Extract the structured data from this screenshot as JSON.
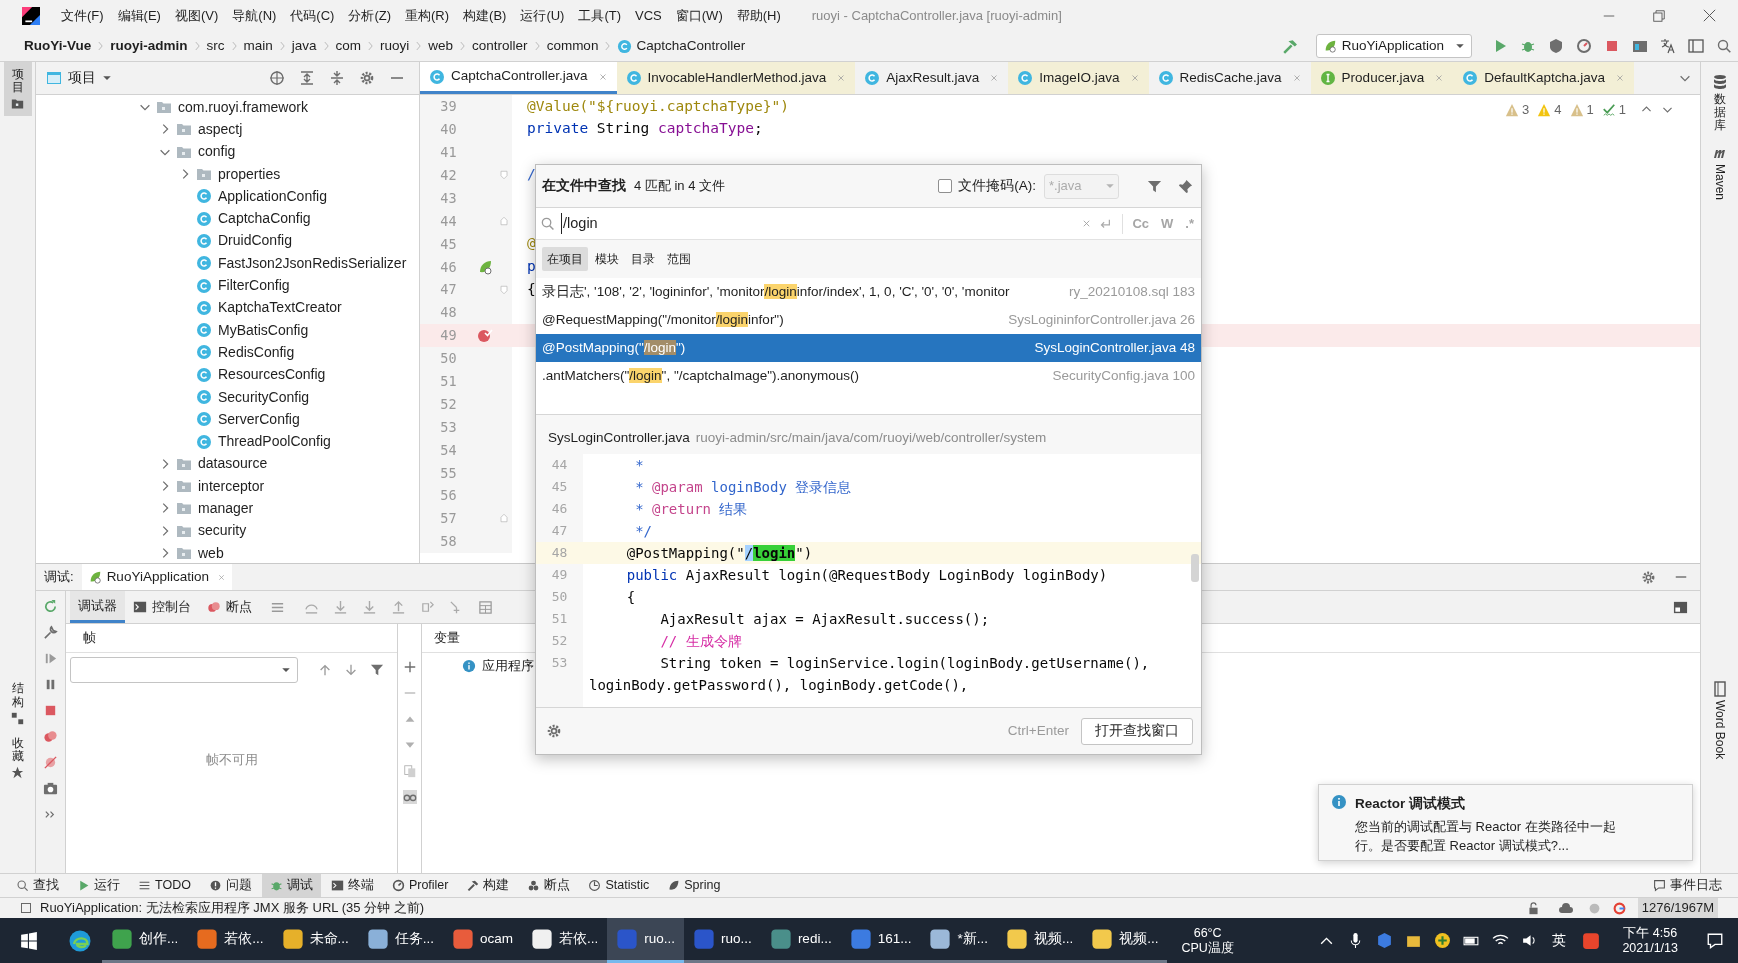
{
  "title_bar": {
    "menu": [
      "文件(F)",
      "编辑(E)",
      "视图(V)",
      "导航(N)",
      "代码(C)",
      "分析(Z)",
      "重构(R)",
      "构建(B)",
      "运行(U)",
      "工具(T)",
      "VCS",
      "窗口(W)",
      "帮助(H)"
    ],
    "title": "ruoyi - CaptchaController.java [ruoyi-admin]"
  },
  "nav_bar": {
    "breadcrumbs": [
      {
        "label": "RuoYi-Vue",
        "kind": "project"
      },
      {
        "label": "ruoyi-admin",
        "kind": "module"
      },
      {
        "label": "src",
        "kind": "dir"
      },
      {
        "label": "main",
        "kind": "dir"
      },
      {
        "label": "java",
        "kind": "dir"
      },
      {
        "label": "com",
        "kind": "dir"
      },
      {
        "label": "ruoyi",
        "kind": "dir"
      },
      {
        "label": "web",
        "kind": "dir"
      },
      {
        "label": "controller",
        "kind": "dir"
      },
      {
        "label": "common",
        "kind": "dir"
      },
      {
        "label": "CaptchaController",
        "kind": "class"
      }
    ],
    "run_config": "RuoYiApplication"
  },
  "left_stripe": [
    {
      "label": "项目",
      "selected": true
    },
    {
      "label": "结构",
      "selected": false
    },
    {
      "label": "收藏",
      "selected": false
    }
  ],
  "right_stripe": [
    {
      "label": "数据库",
      "kind": "cjk"
    },
    {
      "label": "Maven",
      "kind": "latin"
    },
    {
      "label": "Word Book",
      "kind": "latin"
    }
  ],
  "project": {
    "title": "项目",
    "tree": [
      {
        "label": "com.ruoyi.framework",
        "kind": "folder",
        "expanded": true,
        "children": [
          {
            "label": "aspectj",
            "kind": "folder",
            "expanded": false
          },
          {
            "label": "config",
            "kind": "folder",
            "expanded": true,
            "children": [
              {
                "label": "properties",
                "kind": "folder",
                "expanded": false
              },
              {
                "label": "ApplicationConfig",
                "kind": "class"
              },
              {
                "label": "CaptchaConfig",
                "kind": "class"
              },
              {
                "label": "DruidConfig",
                "kind": "class"
              },
              {
                "label": "FastJson2JsonRedisSerializer",
                "kind": "class"
              },
              {
                "label": "FilterConfig",
                "kind": "class"
              },
              {
                "label": "KaptchaTextCreator",
                "kind": "class"
              },
              {
                "label": "MyBatisConfig",
                "kind": "class"
              },
              {
                "label": "RedisConfig",
                "kind": "class"
              },
              {
                "label": "ResourcesConfig",
                "kind": "class"
              },
              {
                "label": "SecurityConfig",
                "kind": "class"
              },
              {
                "label": "ServerConfig",
                "kind": "class"
              },
              {
                "label": "ThreadPoolConfig",
                "kind": "class"
              }
            ]
          },
          {
            "label": "datasource",
            "kind": "folder",
            "expanded": false
          },
          {
            "label": "interceptor",
            "kind": "folder",
            "expanded": false
          },
          {
            "label": "manager",
            "kind": "folder",
            "expanded": false
          },
          {
            "label": "security",
            "kind": "folder",
            "expanded": false
          },
          {
            "label": "web",
            "kind": "folder",
            "expanded": false
          }
        ]
      }
    ]
  },
  "editor": {
    "tabs": [
      {
        "label": "CaptchaController.java",
        "kind": "class",
        "external": false,
        "selected": true
      },
      {
        "label": "InvocableHandlerMethod.java",
        "kind": "class",
        "external": true,
        "selected": false
      },
      {
        "label": "AjaxResult.java",
        "kind": "class",
        "external": false,
        "selected": false
      },
      {
        "label": "ImageIO.java",
        "kind": "class",
        "external": true,
        "selected": false
      },
      {
        "label": "RedisCache.java",
        "kind": "class",
        "external": false,
        "selected": false
      },
      {
        "label": "Producer.java",
        "kind": "interface",
        "external": true,
        "selected": false
      },
      {
        "label": "DefaultKaptcha.java",
        "kind": "class",
        "external": true,
        "selected": false
      }
    ],
    "inspections": [
      {
        "kind": "weak",
        "count": "3"
      },
      {
        "kind": "warning",
        "count": "4"
      },
      {
        "kind": "weak",
        "count": "1"
      },
      {
        "kind": "typo",
        "count": "1"
      }
    ],
    "lines": [
      {
        "number": "39",
        "kind": "plain",
        "highlighted": false,
        "code": [
          {
            "text": "@Value(\"${ruoyi.captchaType}\")",
            "kind": "ann"
          }
        ]
      },
      {
        "number": "40",
        "kind": "plain",
        "highlighted": false,
        "code": [
          {
            "text": "private",
            "kind": "kw"
          },
          {
            "text": " String ",
            "kind": "plain"
          },
          {
            "text": "captchaType",
            "kind": "field"
          },
          {
            "text": ";",
            "kind": "plain"
          }
        ]
      },
      {
        "number": "41",
        "kind": "plain",
        "highlighted": false
      },
      {
        "number": "42",
        "kind": "fold-start",
        "highlighted": false,
        "code": [
          {
            "text": "/",
            "kind": "doc"
          }
        ]
      },
      {
        "number": "43",
        "kind": "plain",
        "highlighted": false
      },
      {
        "number": "44",
        "kind": "fold-end",
        "highlighted": false
      },
      {
        "number": "45",
        "kind": "plain",
        "highlighted": false,
        "code": [
          {
            "text": "@",
            "kind": "ann"
          }
        ]
      },
      {
        "number": "46",
        "kind": "bean",
        "highlighted": false,
        "code": [
          {
            "text": "p",
            "kind": "kw"
          }
        ]
      },
      {
        "number": "47",
        "kind": "fold-start",
        "highlighted": false,
        "code": [
          {
            "text": "{",
            "kind": "plain"
          }
        ]
      },
      {
        "number": "48",
        "kind": "plain",
        "highlighted": false
      },
      {
        "number": "49",
        "kind": "breakpoint",
        "highlighted": true
      },
      {
        "number": "50",
        "kind": "plain",
        "highlighted": false
      },
      {
        "number": "51",
        "kind": "plain",
        "highlighted": false
      },
      {
        "number": "52",
        "kind": "plain",
        "highlighted": false
      },
      {
        "number": "53",
        "kind": "plain",
        "highlighted": false
      },
      {
        "number": "54",
        "kind": "plain",
        "highlighted": false
      },
      {
        "number": "55",
        "kind": "plain",
        "highlighted": false
      },
      {
        "number": "56",
        "kind": "plain",
        "highlighted": false
      },
      {
        "number": "57",
        "kind": "fold-end",
        "highlighted": false
      },
      {
        "number": "58",
        "kind": "plain",
        "highlighted": false
      }
    ]
  },
  "find_popup": {
    "title": "在文件中查找",
    "summary": "4 匹配 in 4 文件",
    "file_mask": {
      "label": "文件掩码(A):",
      "checked": false,
      "value": "*.java"
    },
    "search": {
      "value": "/login"
    },
    "search_options": [
      "Cc",
      "W",
      ".*"
    ],
    "scopes": [
      {
        "label": "在项目",
        "selected": true
      },
      {
        "label": "模块",
        "selected": false
      },
      {
        "label": "目录",
        "selected": false
      },
      {
        "label": "范围",
        "selected": false
      }
    ],
    "results": [
      {
        "before": "录日志', '108', '2', 'logininfor', 'monitor",
        "match": "/login",
        "after": "infor/index', 1, 0, 'C', '0', '0', 'monitor",
        "file": "ry_20210108.sql",
        "line": "183",
        "selected": false
      },
      {
        "before": "@RequestMapping(\"/monitor",
        "match": "/login",
        "after": "infor\")",
        "file": "SysLogininforController.java",
        "line": "26",
        "selected": false
      },
      {
        "before": "@PostMapping(\"",
        "match": "/login",
        "after": "\")",
        "file": "SysLoginController.java",
        "line": "48",
        "selected": true
      },
      {
        "before": ".antMatchers(\"",
        "match": "/login",
        "after": "\", \"/captchaImage\").anonymous()",
        "file": "SecurityConfig.java",
        "line": "100",
        "selected": false
      }
    ],
    "preview": {
      "file": "SysLoginController.java",
      "path": "ruoyi-admin/src/main/java/com/ruoyi/web/controller/system",
      "lines": [
        {
          "number": "44",
          "current": false,
          "code": [
            {
              "text": "     *",
              "kind": "doc"
            }
          ]
        },
        {
          "number": "45",
          "current": false,
          "code": [
            {
              "text": "     * ",
              "kind": "doc"
            },
            {
              "text": "@param",
              "kind": "tag"
            },
            {
              "text": " loginBody 登录信息",
              "kind": "doc"
            }
          ]
        },
        {
          "number": "46",
          "current": false,
          "code": [
            {
              "text": "     * ",
              "kind": "doc"
            },
            {
              "text": "@return",
              "kind": "tag"
            },
            {
              "text": " 结果",
              "kind": "doc"
            }
          ]
        },
        {
          "number": "47",
          "current": false,
          "code": [
            {
              "text": "     */",
              "kind": "doc"
            }
          ]
        },
        {
          "number": "48",
          "current": true,
          "code": [
            {
              "text": "    @PostMapping(\"",
              "kind": "plain"
            },
            {
              "text": "/",
              "kind": "sel"
            },
            {
              "text": "login",
              "kind": "hit"
            },
            {
              "text": "\")",
              "kind": "plain"
            }
          ]
        },
        {
          "number": "49",
          "current": false,
          "code": [
            {
              "text": "    public",
              "kind": "kw"
            },
            {
              "text": " AjaxResult login(@RequestBody LoginBody loginBody)",
              "kind": "plain"
            }
          ]
        },
        {
          "number": "50",
          "current": false,
          "code": [
            {
              "text": "    {",
              "kind": "plain"
            }
          ]
        },
        {
          "number": "51",
          "current": false,
          "code": [
            {
              "text": "        AjaxResult ajax = AjaxResult.success();",
              "kind": "plain"
            }
          ]
        },
        {
          "number": "52",
          "current": false,
          "code": [
            {
              "text": "        // 生成令牌",
              "kind": "cm"
            }
          ]
        },
        {
          "number": "53",
          "current": false,
          "code": [
            {
              "text": "        String token = loginService.login(loginBody.getUsername(),",
              "kind": "plain"
            }
          ],
          "wrap": [
            {
              "text": "loginBody.getPassword(), loginBody.getCode(),",
              "kind": "plain"
            }
          ]
        }
      ]
    },
    "shortcut": "Ctrl+Enter",
    "open_button": "打开查找窗口"
  },
  "debug": {
    "label": "调试:",
    "session": "RuoYiApplication",
    "tabs": [
      {
        "label": "调试器",
        "selected": true
      },
      {
        "label": "控制台",
        "selected": false
      },
      {
        "label": "断点",
        "selected": false
      }
    ],
    "frames_header": "帧",
    "variables_header": "变量",
    "frames_empty": "帧不可用",
    "variables": [
      "应用程序"
    ]
  },
  "notification": {
    "title": "Reactor 调试模式",
    "body": [
      "您当前的调试配置与 Reactor 在类路径中一起",
      "行。是否要配置 Reactor 调试模式?..."
    ]
  },
  "tool_strip": {
    "items": [
      {
        "label": "查找",
        "selected": false
      },
      {
        "label": "运行",
        "selected": false
      },
      {
        "label": "TODO",
        "selected": false
      },
      {
        "label": "问题",
        "selected": false
      },
      {
        "label": "调试",
        "selected": true
      },
      {
        "label": "终端",
        "selected": false
      },
      {
        "label": "Profiler",
        "selected": false
      },
      {
        "label": "构建",
        "selected": false
      },
      {
        "label": "断点",
        "selected": false
      },
      {
        "label": "Statistic",
        "selected": false
      },
      {
        "label": "Spring",
        "selected": false
      }
    ],
    "event_log": "事件日志"
  },
  "status_bar": {
    "message": "RuoYiApplication: 无法检索应用程序 JMX 服务 URL (35 分钟 之前)",
    "memory": "1276/1967M"
  },
  "taskbar": {
    "apps": [
      {
        "label": "创作...",
        "selected": false
      },
      {
        "label": "若依...",
        "selected": false
      },
      {
        "label": "未命...",
        "selected": false
      },
      {
        "label": "任务...",
        "selected": false
      },
      {
        "label": "ocam",
        "selected": false
      },
      {
        "label": "若依...",
        "selected": false
      },
      {
        "label": "ruo...",
        "selected": true
      },
      {
        "label": "ruo...",
        "selected": false
      },
      {
        "label": "redi...",
        "selected": false
      },
      {
        "label": "161...",
        "selected": false
      },
      {
        "label": "*新...",
        "selected": false
      },
      {
        "label": "视频...",
        "selected": false
      },
      {
        "label": "视频...",
        "selected": false
      }
    ],
    "temperature": "66°C",
    "temperature_label": "CPU温度",
    "ime": "英",
    "time": "下午 4:56",
    "date": "2021/1/13"
  }
}
